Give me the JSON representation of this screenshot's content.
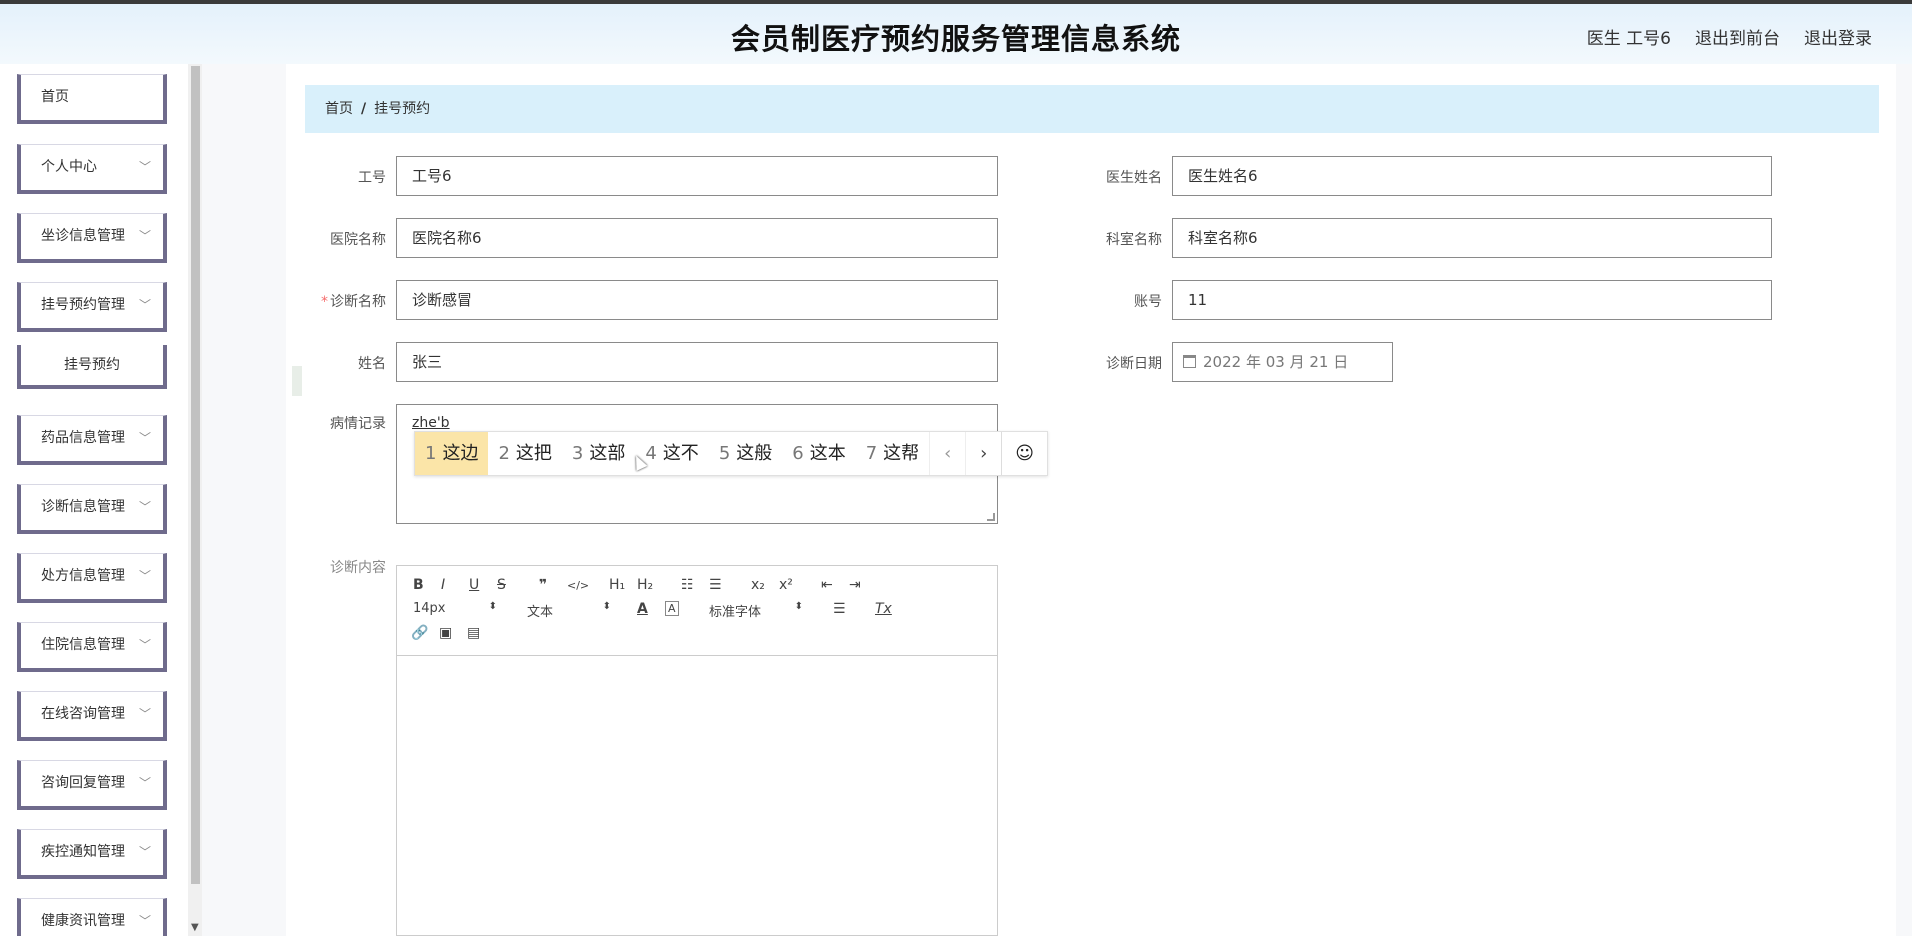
{
  "header": {
    "title": "会员制医疗预约服务管理信息系统",
    "user": "医生 工号6",
    "back_to_front": "退出到前台",
    "logout": "退出登录"
  },
  "sidebar": {
    "items": [
      {
        "label": "首页"
      },
      {
        "label": "个人中心"
      },
      {
        "label": "坐诊信息管理"
      },
      {
        "label": "挂号预约管理"
      },
      {
        "label": "挂号预约"
      },
      {
        "label": "药品信息管理"
      },
      {
        "label": "诊断信息管理"
      },
      {
        "label": "处方信息管理"
      },
      {
        "label": "住院信息管理"
      },
      {
        "label": "在线咨询管理"
      },
      {
        "label": "咨询回复管理"
      },
      {
        "label": "疾控通知管理"
      },
      {
        "label": "健康资讯管理"
      }
    ]
  },
  "breadcrumb": {
    "home": "首页",
    "sep": "/",
    "current": "挂号预约"
  },
  "form": {
    "job_no": {
      "label": "工号",
      "value": "工号6"
    },
    "doctor_name": {
      "label": "医生姓名",
      "value": "医生姓名6"
    },
    "hospital": {
      "label": "医院名称",
      "value": "医院名称6"
    },
    "department": {
      "label": "科室名称",
      "value": "科室名称6"
    },
    "diagnosis": {
      "label": "诊断名称",
      "required": "*",
      "value": "诊断感冒"
    },
    "account": {
      "label": "账号",
      "value": "11"
    },
    "name": {
      "label": "姓名",
      "value": "张三"
    },
    "date": {
      "label": "诊断日期",
      "value": "2022 年 03 月 21 日"
    },
    "record": {
      "label": "病情记录",
      "value": "zhe'b"
    },
    "content": {
      "label": "诊断内容"
    }
  },
  "ime": {
    "candidates": [
      {
        "n": "1",
        "text": "这边"
      },
      {
        "n": "2",
        "text": "这把"
      },
      {
        "n": "3",
        "text": "这部"
      },
      {
        "n": "4",
        "text": "这不"
      },
      {
        "n": "5",
        "text": "这般"
      },
      {
        "n": "6",
        "text": "这本"
      },
      {
        "n": "7",
        "text": "这帮"
      }
    ],
    "prev": "‹",
    "next": "›",
    "emoji": "☺"
  },
  "editor": {
    "bold": "B",
    "italic": "I",
    "underline": "U",
    "strike": "S",
    "quote": "❞",
    "code": "</>",
    "h1": "H₁",
    "h2": "H₂",
    "ol": "☷",
    "ul": "☰",
    "sub": "x₂",
    "sup": "x²",
    "outdent": "⇤",
    "indent": "⇥",
    "size": "14px",
    "block": "文本",
    "font": "标准字体",
    "align": "☰",
    "clear": "Tx",
    "link": "🔗",
    "image": "▣",
    "video": "▤"
  },
  "colors": {
    "accent": "#6f6b8c",
    "breadcrumb_bg": "#d9f0fb",
    "ime_selected": "#fbe5a8"
  }
}
